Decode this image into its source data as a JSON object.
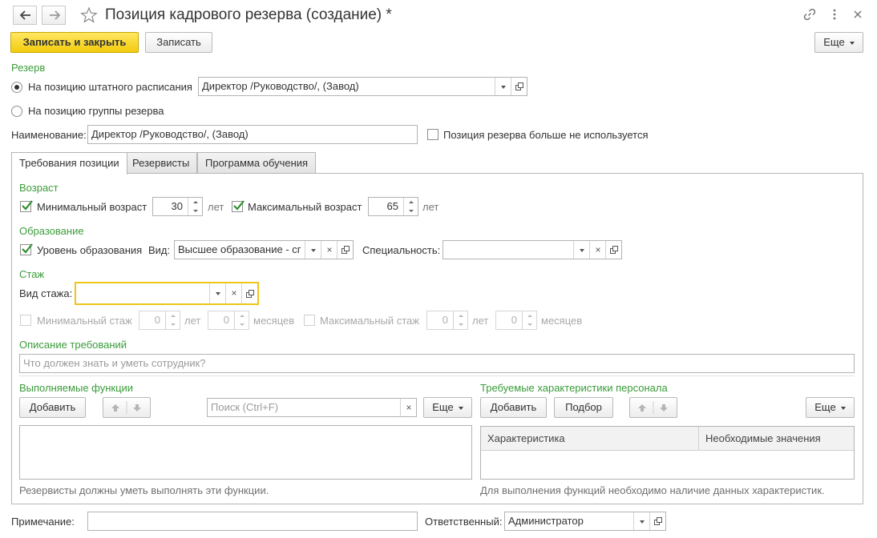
{
  "window": {
    "title": "Позиция кадрового резерва (создание) *"
  },
  "toolbar": {
    "save_close_label": "Записать и закрыть",
    "save_label": "Записать",
    "more_label": "Еще"
  },
  "reserve": {
    "section_label": "Резерв",
    "option_staff_label": "На позицию штатного расписания",
    "option_staff_value": "Директор /Руководство/, (Завод)",
    "option_group_label": "На позицию группы резерва",
    "name_label": "Наименование:",
    "name_value": "Директор /Руководство/, (Завод)",
    "not_used_label": "Позиция резерва больше не используется"
  },
  "tabs": [
    {
      "label": "Требования позиции",
      "active": true
    },
    {
      "label": "Резервисты",
      "active": false
    },
    {
      "label": "Программа обучения",
      "active": false
    }
  ],
  "age": {
    "section_label": "Возраст",
    "min_label": "Минимальный возраст",
    "min_value": "30",
    "min_unit": "лет",
    "max_label": "Максимальный возраст",
    "max_value": "65",
    "max_unit": "лет"
  },
  "education": {
    "section_label": "Образование",
    "level_label": "Уровень образования",
    "kind_label": "Вид:",
    "kind_value": "Высшее образование - сг",
    "specialty_label": "Специальность:",
    "specialty_value": ""
  },
  "experience": {
    "section_label": "Стаж",
    "kind_label": "Вид стажа:",
    "kind_value": "",
    "min_label": "Минимальный стаж",
    "min_years": "0",
    "min_years_unit": "лет",
    "min_months": "0",
    "min_months_unit": "месяцев",
    "max_label": "Максимальный стаж",
    "max_years": "0",
    "max_years_unit": "лет",
    "max_months": "0",
    "max_months_unit": "месяцев"
  },
  "description": {
    "section_label": "Описание требований",
    "placeholder": "Что должен знать и уметь сотрудник?"
  },
  "functions": {
    "section_label": "Выполняемые функции",
    "add_label": "Добавить",
    "search_placeholder": "Поиск (Ctrl+F)",
    "more_label": "Еще",
    "hint": "Резервисты должны уметь выполнять эти функции."
  },
  "characteristics": {
    "section_label": "Требуемые характеристики персонала",
    "add_label": "Добавить",
    "pick_label": "Подбор",
    "more_label": "Еще",
    "columns": [
      "Характеристика",
      "Необходимые значения"
    ],
    "hint": "Для выполнения функций необходимо наличие данных характеристик."
  },
  "footer": {
    "note_label": "Примечание:",
    "note_value": "",
    "responsible_label": "Ответственный:",
    "responsible_value": "Администратор"
  },
  "colors": {
    "accent_green": "#3a9c3a",
    "primary_button": "#f2cb0d",
    "focus_border": "#f0c419"
  }
}
